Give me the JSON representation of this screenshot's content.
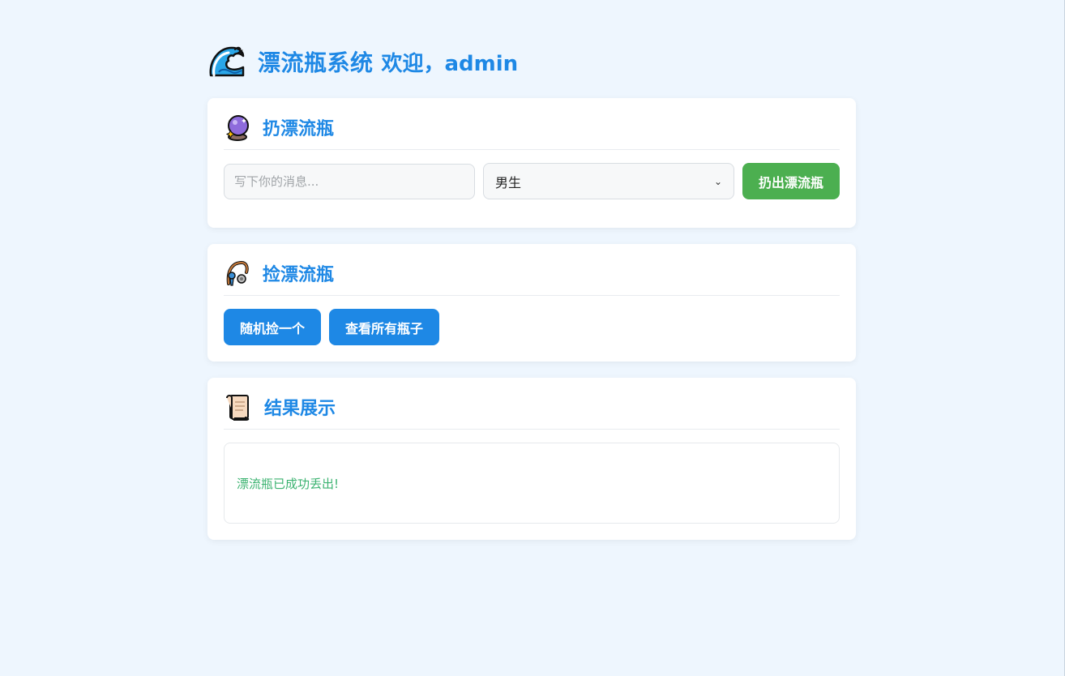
{
  "header": {
    "title": "漂流瓶系统",
    "welcome": "欢迎，admin",
    "logo_icon": "wave-icon"
  },
  "throw_section": {
    "title": "扔漂流瓶",
    "icon": "crystal-ball-icon",
    "message_placeholder": "写下你的消息...",
    "message_value": "",
    "gender_selected": "男生",
    "submit_label": "扔出漂流瓶"
  },
  "pick_section": {
    "title": "捡漂流瓶",
    "icon": "fishing-icon",
    "random_label": "随机捡一个",
    "view_all_label": "查看所有瓶子"
  },
  "result_section": {
    "title": "结果展示",
    "icon": "scroll-icon",
    "message": "漂流瓶已成功丢出!"
  },
  "colors": {
    "accent": "#1e88e5",
    "success": "#4caf50",
    "success_text": "#3cb371",
    "background": "#eef6fe"
  }
}
